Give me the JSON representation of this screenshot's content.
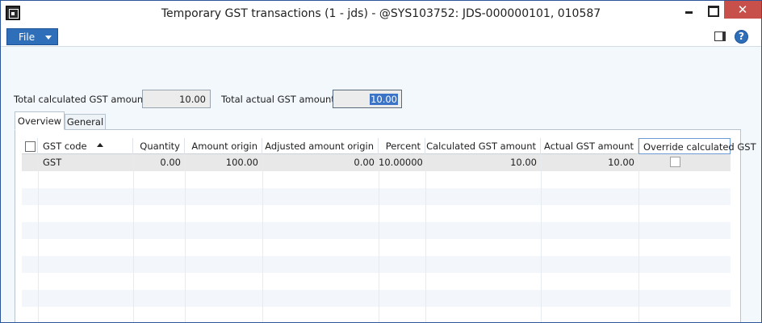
{
  "window": {
    "title": "Temporary GST transactions (1 - jds) - @SYS103752: JDS-000000101, 010587",
    "close_glyph": "✕"
  },
  "menu": {
    "file_label": "File",
    "help_glyph": "?"
  },
  "totals": {
    "calculated_label": "Total calculated GST amount:",
    "calculated_value": "10.00",
    "actual_label": "Total actual GST amount:",
    "actual_value": "10.00"
  },
  "tabs": [
    {
      "label": "Overview",
      "active": true
    },
    {
      "label": "General",
      "active": false
    }
  ],
  "grid": {
    "columns": [
      "GST code",
      "Quantity",
      "Amount origin",
      "Adjusted amount origin",
      "Percent",
      "Calculated GST amount",
      "Actual GST amount",
      "Override calculated GST"
    ],
    "rows": [
      {
        "gst_code": "GST",
        "quantity": "0.00",
        "amount_origin": "100.00",
        "adjusted_amount_origin": "0.00",
        "percent": "10.00000",
        "calculated_gst_amount": "10.00",
        "actual_gst_amount": "10.00",
        "override_calculated_gst": false
      }
    ]
  }
}
